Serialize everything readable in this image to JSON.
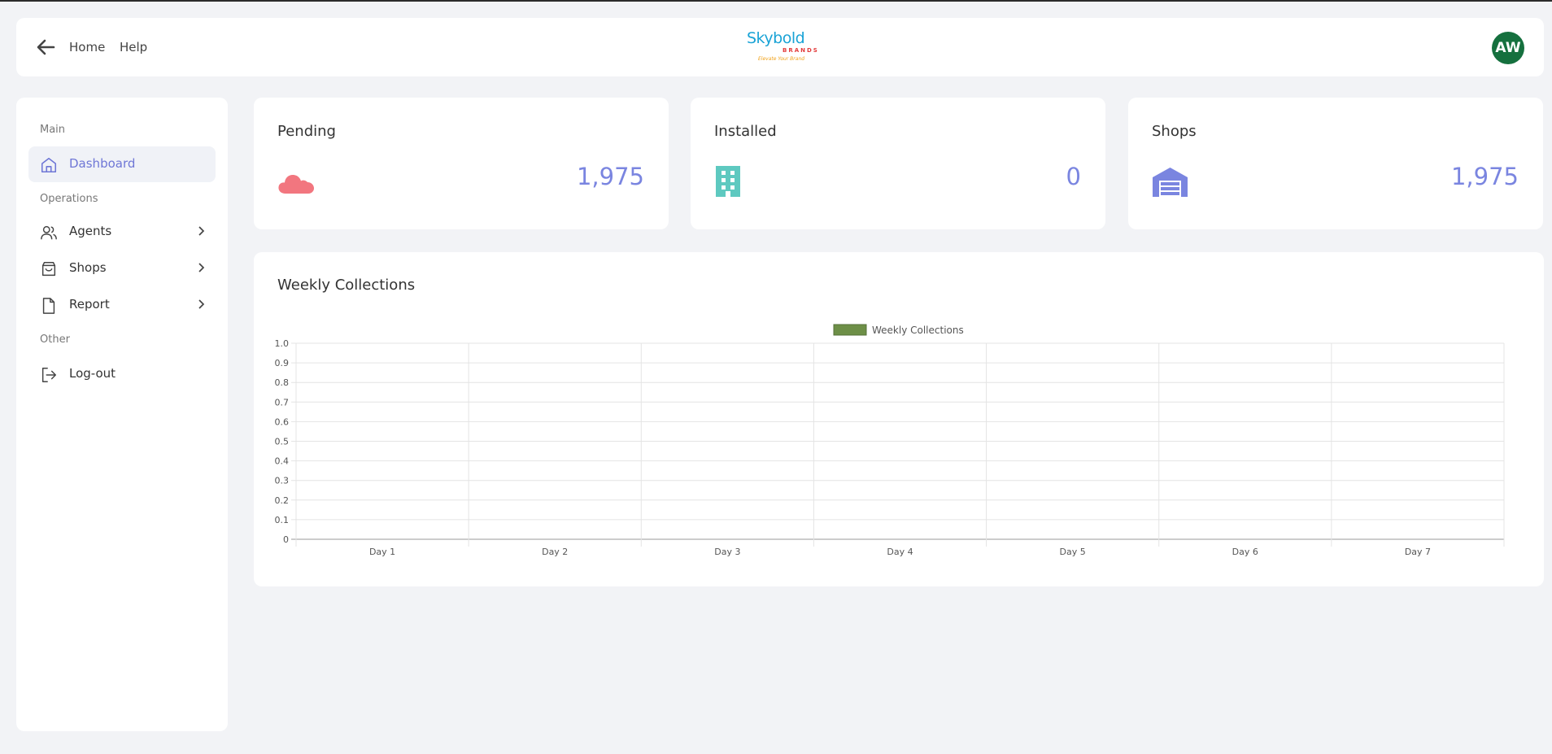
{
  "header": {
    "nav": {
      "home": "Home",
      "help": "Help"
    },
    "logo": {
      "word": "Skybold",
      "sub": "BRANDS",
      "tagline": "Elevate Your Brand"
    },
    "avatar_initials": "AW"
  },
  "sidebar": {
    "sections": {
      "main": "Main",
      "operations": "Operations",
      "other": "Other"
    },
    "items": [
      {
        "label": "Dashboard",
        "icon": "home-icon",
        "active": true
      },
      {
        "label": "Agents",
        "icon": "users-icon"
      },
      {
        "label": "Shops",
        "icon": "shopping-bag-icon"
      },
      {
        "label": "Report",
        "icon": "file-icon"
      },
      {
        "label": "Log-out",
        "icon": "logout-icon"
      }
    ]
  },
  "stats": [
    {
      "title": "Pending",
      "value": "1,975",
      "icon": "cloud-icon",
      "color": "#f2767f"
    },
    {
      "title": "Installed",
      "value": "0",
      "icon": "building-icon",
      "color": "#5ec9c0"
    },
    {
      "title": "Shops",
      "value": "1,975",
      "icon": "warehouse-icon",
      "color": "#7a85e0"
    }
  ],
  "chart_title": "Weekly Collections",
  "chart_data": {
    "type": "bar",
    "categories": [
      "Day 1",
      "Day 2",
      "Day 3",
      "Day 4",
      "Day 5",
      "Day 6",
      "Day 7"
    ],
    "series": [
      {
        "name": "Weekly Collections",
        "values": [
          0,
          0,
          0,
          0,
          0,
          0,
          0
        ],
        "color": "#6d8f47"
      }
    ],
    "ylim": [
      0,
      1
    ],
    "yticks": [
      "0",
      "0.1",
      "0.2",
      "0.3",
      "0.4",
      "0.5",
      "0.6",
      "0.7",
      "0.8",
      "0.9",
      "1.0"
    ],
    "grid": true,
    "legend": "top-center"
  }
}
